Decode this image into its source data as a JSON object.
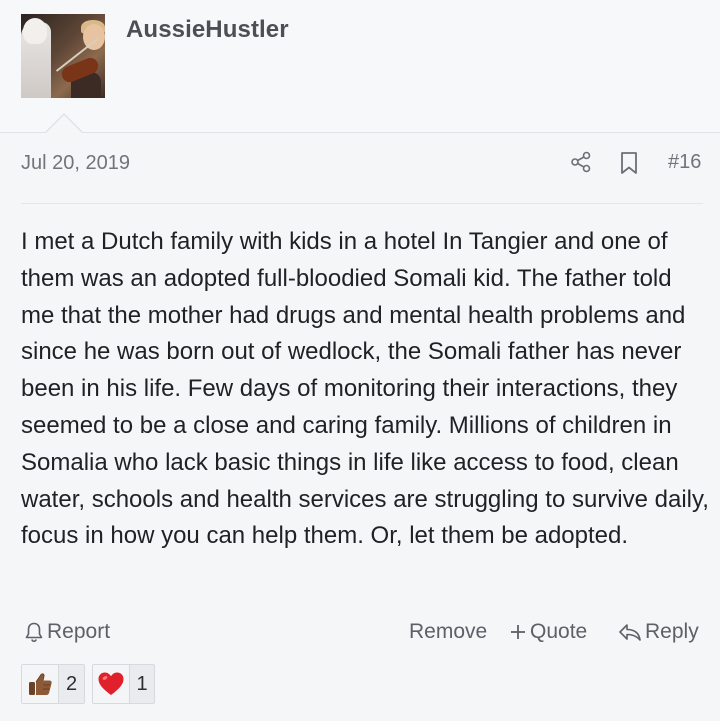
{
  "post": {
    "author": "AussieHustler",
    "date": "Jul 20, 2019",
    "number": "#16",
    "body": "I met a Dutch family with kids in a hotel In Tangier and one of them was an adopted full-bloodied Somali kid. The father told me that the mother had drugs and mental health problems and since he was born out of wedlock, the Somali father has never been in his life. Few days of monitoring their interactions, they seemed to be a close and caring family. Millions of children in Somalia who lack basic things in life like access to food, clean water, schools and health services are struggling to survive daily, focus in how you can help them. Or, let them be adopted."
  },
  "actions": {
    "report_label": "Report",
    "remove_label": "Remove",
    "quote_label": "Quote",
    "reply_label": "Reply"
  },
  "reactions": [
    {
      "icon": "thumbs-up-icon",
      "count": "2"
    },
    {
      "icon": "heart-icon",
      "count": "1"
    }
  ],
  "icons": {
    "share": "share-icon",
    "bookmark": "bookmark-icon",
    "report": "bell-icon",
    "quote": "plus-icon",
    "reply": "reply-arrow-icon"
  },
  "colors": {
    "background": "#f5f6f8",
    "username": "#4c4f54",
    "meta_text": "#70757c",
    "body_text": "#1f2124",
    "action_text": "#5c6168"
  }
}
